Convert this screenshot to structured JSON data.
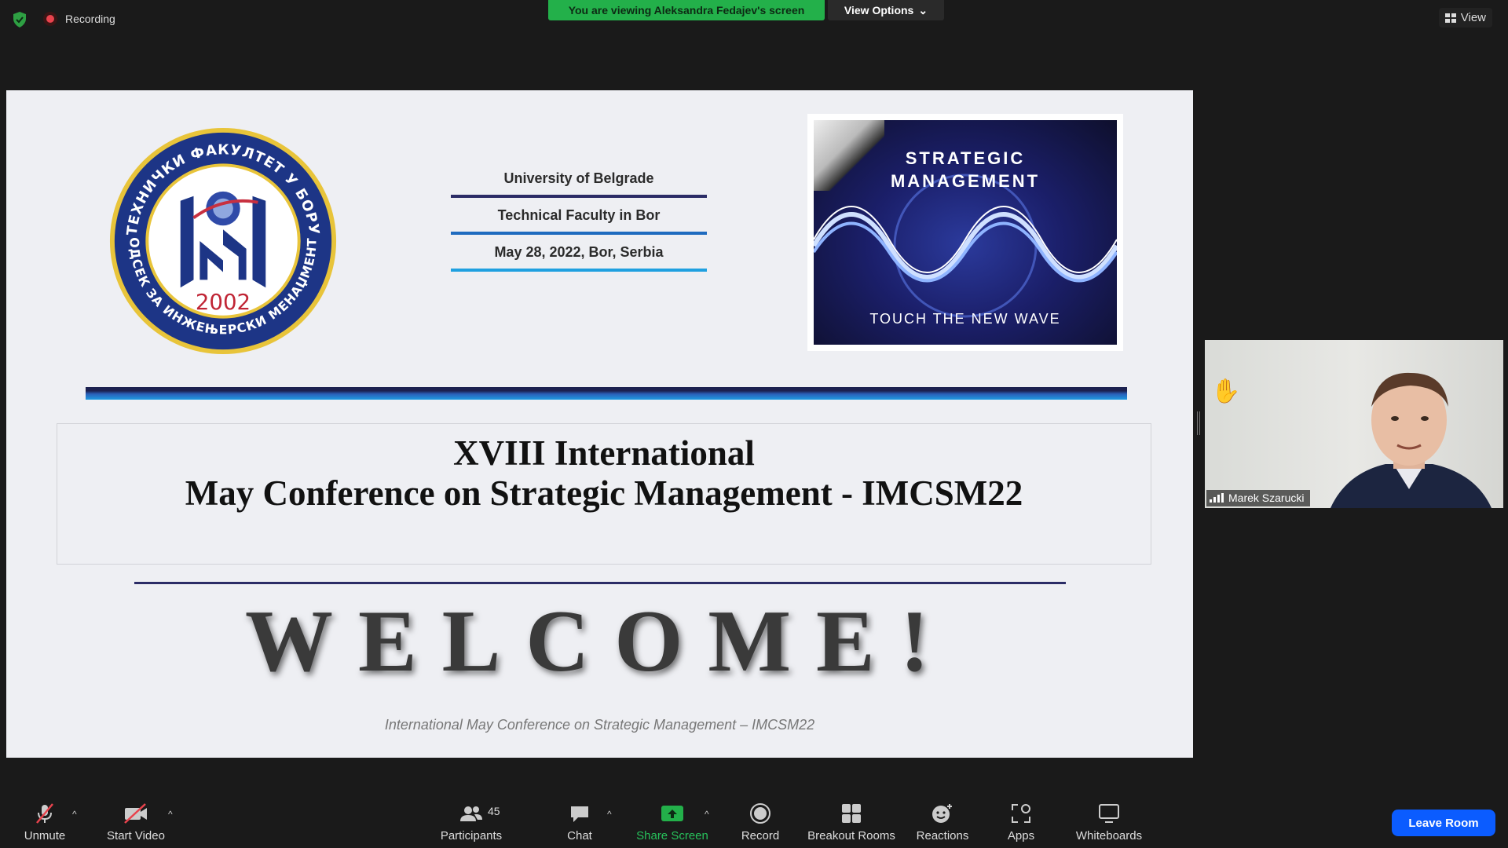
{
  "topbar": {
    "recording_label": "Recording",
    "viewing_banner": "You are viewing Aleksandra Fedajev's screen",
    "view_options_label": "View Options",
    "view_label": "View"
  },
  "slide": {
    "seal_year": "2002",
    "seal_text_top": "ТЕХНИЧКИ ФАКУЛТЕТ У БОРУ",
    "seal_text_bottom": "ОДСЕК ЗА ИНЖЕЊЕРСКИ МЕНАЏМЕНТ",
    "info": [
      "University of Belgrade",
      "Technical Faculty in Bor",
      "May 28, 2022, Bor, Serbia"
    ],
    "sm_title_1": "STRATEGIC",
    "sm_title_2": "MANAGEMENT",
    "sm_tagline": "TOUCH THE NEW WAVE",
    "conf_line_1": "XVIII International",
    "conf_line_2": "May Conference on Strategic Management - IMCSM22",
    "welcome": "WELCOME!",
    "footer": "International May Conference on Strategic Management – IMCSM22"
  },
  "video": {
    "participant_name": "Marek Szarucki"
  },
  "toolbar": {
    "unmute": "Unmute",
    "start_video": "Start Video",
    "participants": "Participants",
    "participants_count": "45",
    "chat": "Chat",
    "share_screen": "Share Screen",
    "record": "Record",
    "breakout_rooms": "Breakout Rooms",
    "reactions": "Reactions",
    "apps": "Apps",
    "whiteboards": "Whiteboards",
    "leave_room": "Leave Room"
  },
  "colors": {
    "share_green": "#27c15b",
    "banner_green": "#23b04a",
    "leave_blue": "#0b5cff",
    "recording_red": "#e8434d"
  }
}
